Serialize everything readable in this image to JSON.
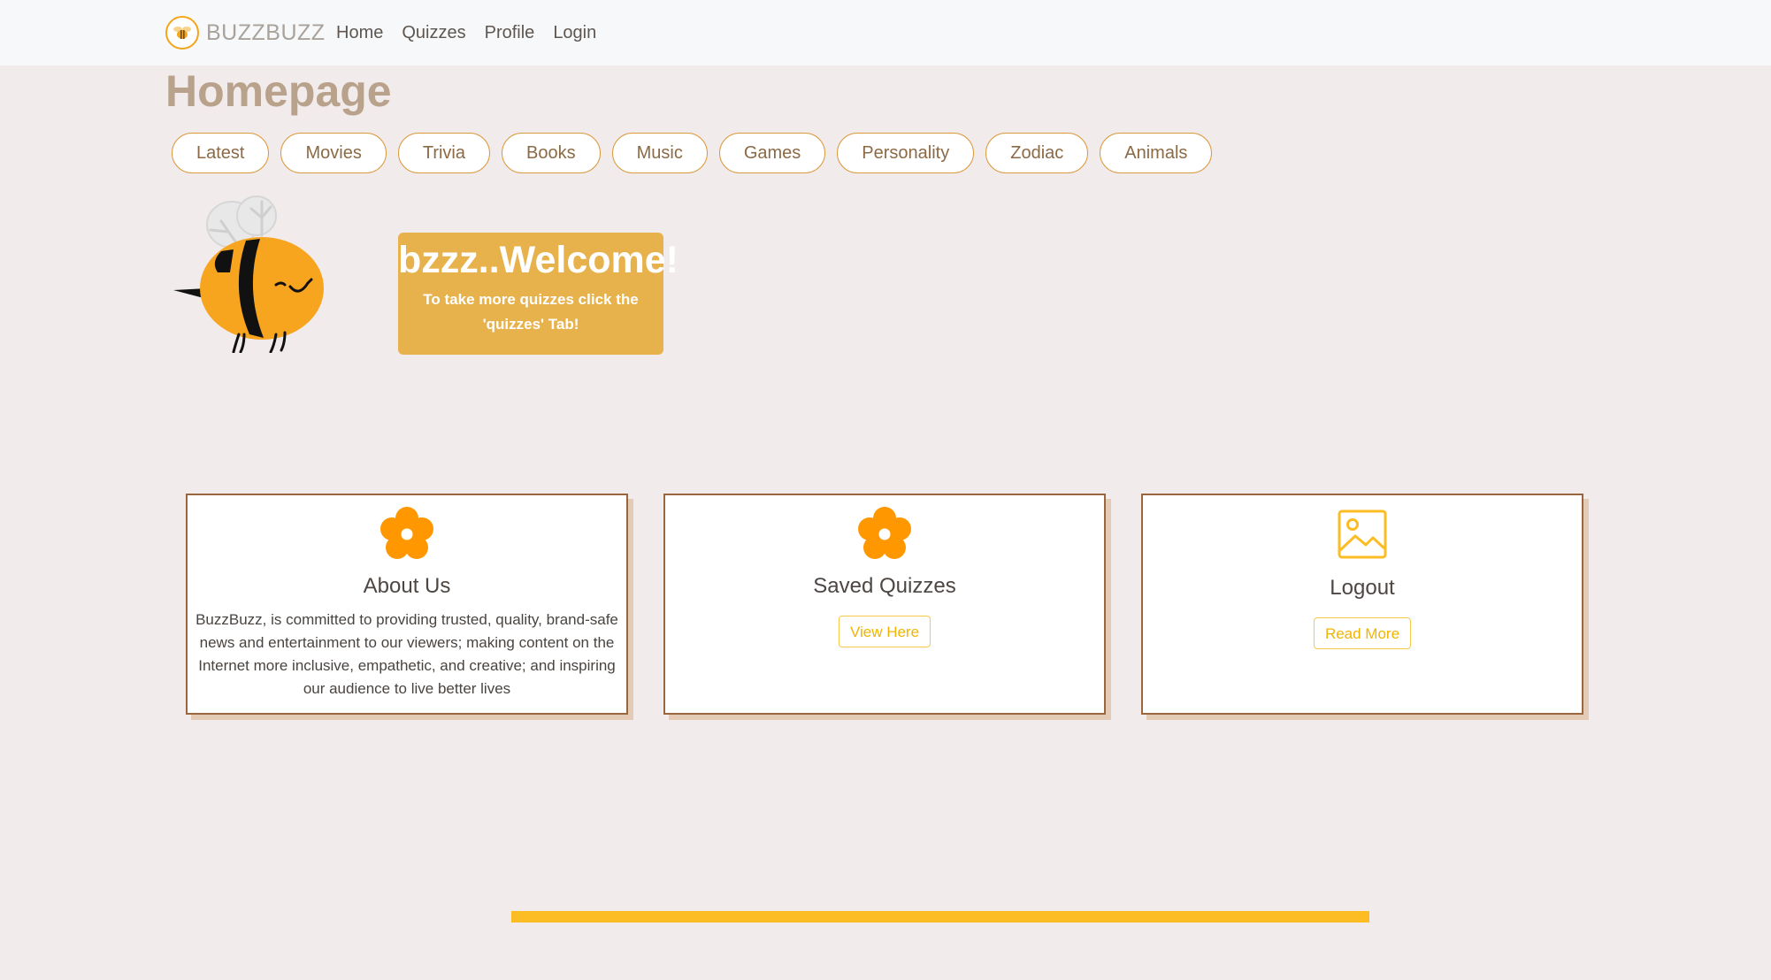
{
  "nav": {
    "brand": "BUZZBUZZ",
    "links": [
      "Home",
      "Quizzes",
      "Profile",
      "Login"
    ]
  },
  "page": {
    "title": "Homepage"
  },
  "categories": [
    "Latest",
    "Movies",
    "Trivia",
    "Books",
    "Music",
    "Games",
    "Personality",
    "Zodiac",
    "Animals"
  ],
  "welcome": {
    "heading": "bzzz..Welcome!",
    "text": "To take more quizzes click the 'quizzes' Tab!"
  },
  "cards": {
    "about": {
      "title": "About Us",
      "text": "BuzzBuzz, is committed to providing trusted, quality, brand-safe news and entertainment to our viewers; making content on the Internet more inclusive, empathetic, and creative; and inspiring our audience to live better lives",
      "icon": "flower-icon"
    },
    "saved": {
      "title": "Saved Quizzes",
      "button": "View Here",
      "icon": "flower-icon"
    },
    "logout": {
      "title": "Logout",
      "button": "Read More",
      "icon": "image-placeholder-icon"
    }
  },
  "colors": {
    "background": "#f2ebeb",
    "accent": "#e7b24b",
    "flower": "#ff9800",
    "card_border": "#99663f",
    "button_text": "#f2b400",
    "progress": "#fbbc24"
  }
}
